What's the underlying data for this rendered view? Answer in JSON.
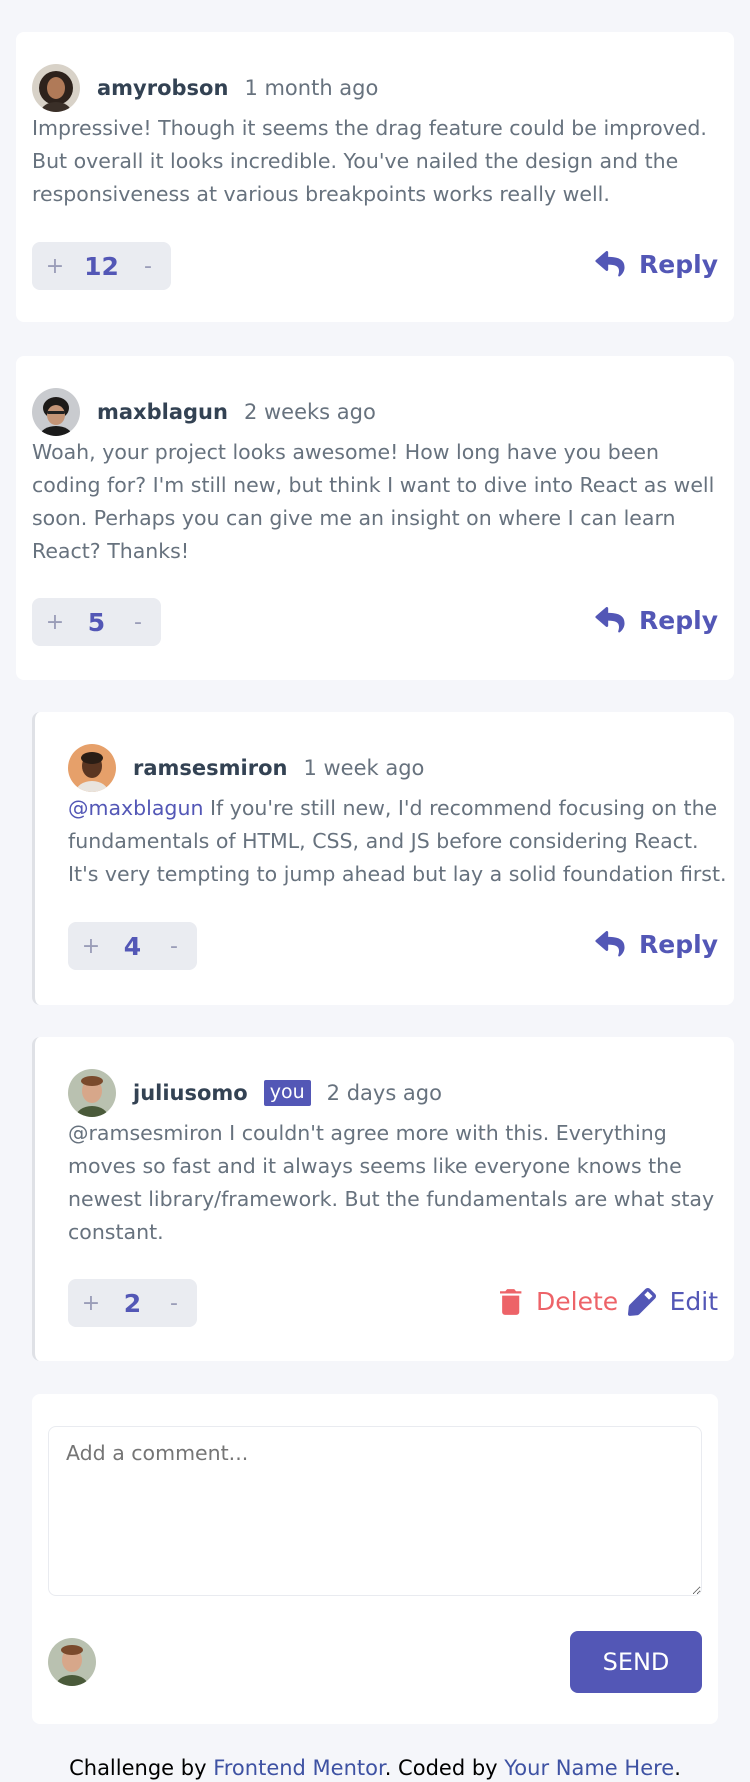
{
  "comments": [
    {
      "username": "amyrobson",
      "time": "1 month ago",
      "content": "Impressive! Though it seems the drag feature could be improved. But overall it looks incredible. You've nailed the design and the responsiveness at various breakpoints works really well.",
      "score": "12",
      "reply_label": "Reply"
    },
    {
      "username": "maxblagun",
      "time": "2 weeks ago",
      "content": "Woah, your project looks awesome! How long have you been coding for? I'm still new, but think I want to dive into React as well soon. Perhaps you can give me an insight on where I can learn React? Thanks!",
      "score": "5",
      "reply_label": "Reply"
    }
  ],
  "replies": [
    {
      "username": "ramsesmiron",
      "time": "1 week ago",
      "mention": "@maxblagun",
      "content": " If you're still new, I'd recommend focusing on the fundamentals of HTML, CSS, and JS before considering React. It's very tempting to jump ahead but lay a solid foundation first.",
      "score": "4",
      "reply_label": "Reply"
    },
    {
      "username": "juliusomo",
      "badge": "you",
      "time": "2 days ago",
      "content": "@ramsesmiron I couldn't agree more with this. Everything moves so fast and it always seems like everyone knows the newest library/framework. But the fundamentals are what stay constant.",
      "score": "2",
      "delete_label": "Delete",
      "edit_label": "Edit"
    }
  ],
  "vote": {
    "plus": "+",
    "minus": "-"
  },
  "composer": {
    "placeholder": "Add a comment...",
    "send_label": "SEND"
  },
  "footer": {
    "prefix": "Challenge by ",
    "link1": "Frontend Mentor",
    "middle": ". Coded by ",
    "link2": "Your Name Here",
    "suffix": "."
  },
  "colors": {
    "primary": "#5357b6",
    "danger": "#ed6368",
    "background": "#f5f6fa",
    "text": "#67727e",
    "heading": "#334253"
  }
}
